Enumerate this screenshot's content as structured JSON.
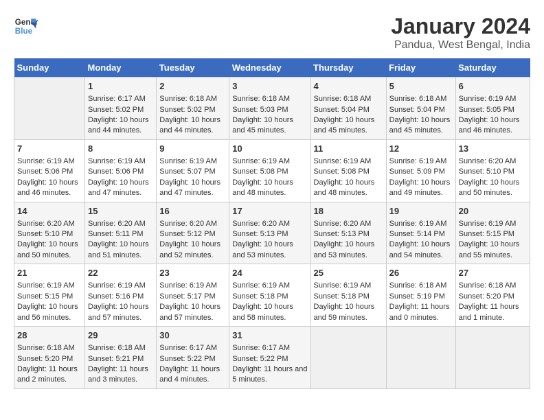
{
  "logo": {
    "text_general": "General",
    "text_blue": "Blue"
  },
  "title": "January 2024",
  "subtitle": "Pandua, West Bengal, India",
  "calendar": {
    "headers": [
      "Sunday",
      "Monday",
      "Tuesday",
      "Wednesday",
      "Thursday",
      "Friday",
      "Saturday"
    ],
    "weeks": [
      [
        {
          "day": "",
          "sunrise": "",
          "sunset": "",
          "daylight": ""
        },
        {
          "day": "1",
          "sunrise": "Sunrise: 6:17 AM",
          "sunset": "Sunset: 5:02 PM",
          "daylight": "Daylight: 10 hours and 44 minutes."
        },
        {
          "day": "2",
          "sunrise": "Sunrise: 6:18 AM",
          "sunset": "Sunset: 5:02 PM",
          "daylight": "Daylight: 10 hours and 44 minutes."
        },
        {
          "day": "3",
          "sunrise": "Sunrise: 6:18 AM",
          "sunset": "Sunset: 5:03 PM",
          "daylight": "Daylight: 10 hours and 45 minutes."
        },
        {
          "day": "4",
          "sunrise": "Sunrise: 6:18 AM",
          "sunset": "Sunset: 5:04 PM",
          "daylight": "Daylight: 10 hours and 45 minutes."
        },
        {
          "day": "5",
          "sunrise": "Sunrise: 6:18 AM",
          "sunset": "Sunset: 5:04 PM",
          "daylight": "Daylight: 10 hours and 45 minutes."
        },
        {
          "day": "6",
          "sunrise": "Sunrise: 6:19 AM",
          "sunset": "Sunset: 5:05 PM",
          "daylight": "Daylight: 10 hours and 46 minutes."
        }
      ],
      [
        {
          "day": "7",
          "sunrise": "Sunrise: 6:19 AM",
          "sunset": "Sunset: 5:06 PM",
          "daylight": "Daylight: 10 hours and 46 minutes."
        },
        {
          "day": "8",
          "sunrise": "Sunrise: 6:19 AM",
          "sunset": "Sunset: 5:06 PM",
          "daylight": "Daylight: 10 hours and 47 minutes."
        },
        {
          "day": "9",
          "sunrise": "Sunrise: 6:19 AM",
          "sunset": "Sunset: 5:07 PM",
          "daylight": "Daylight: 10 hours and 47 minutes."
        },
        {
          "day": "10",
          "sunrise": "Sunrise: 6:19 AM",
          "sunset": "Sunset: 5:08 PM",
          "daylight": "Daylight: 10 hours and 48 minutes."
        },
        {
          "day": "11",
          "sunrise": "Sunrise: 6:19 AM",
          "sunset": "Sunset: 5:08 PM",
          "daylight": "Daylight: 10 hours and 48 minutes."
        },
        {
          "day": "12",
          "sunrise": "Sunrise: 6:19 AM",
          "sunset": "Sunset: 5:09 PM",
          "daylight": "Daylight: 10 hours and 49 minutes."
        },
        {
          "day": "13",
          "sunrise": "Sunrise: 6:20 AM",
          "sunset": "Sunset: 5:10 PM",
          "daylight": "Daylight: 10 hours and 50 minutes."
        }
      ],
      [
        {
          "day": "14",
          "sunrise": "Sunrise: 6:20 AM",
          "sunset": "Sunset: 5:10 PM",
          "daylight": "Daylight: 10 hours and 50 minutes."
        },
        {
          "day": "15",
          "sunrise": "Sunrise: 6:20 AM",
          "sunset": "Sunset: 5:11 PM",
          "daylight": "Daylight: 10 hours and 51 minutes."
        },
        {
          "day": "16",
          "sunrise": "Sunrise: 6:20 AM",
          "sunset": "Sunset: 5:12 PM",
          "daylight": "Daylight: 10 hours and 52 minutes."
        },
        {
          "day": "17",
          "sunrise": "Sunrise: 6:20 AM",
          "sunset": "Sunset: 5:13 PM",
          "daylight": "Daylight: 10 hours and 53 minutes."
        },
        {
          "day": "18",
          "sunrise": "Sunrise: 6:20 AM",
          "sunset": "Sunset: 5:13 PM",
          "daylight": "Daylight: 10 hours and 53 minutes."
        },
        {
          "day": "19",
          "sunrise": "Sunrise: 6:19 AM",
          "sunset": "Sunset: 5:14 PM",
          "daylight": "Daylight: 10 hours and 54 minutes."
        },
        {
          "day": "20",
          "sunrise": "Sunrise: 6:19 AM",
          "sunset": "Sunset: 5:15 PM",
          "daylight": "Daylight: 10 hours and 55 minutes."
        }
      ],
      [
        {
          "day": "21",
          "sunrise": "Sunrise: 6:19 AM",
          "sunset": "Sunset: 5:15 PM",
          "daylight": "Daylight: 10 hours and 56 minutes."
        },
        {
          "day": "22",
          "sunrise": "Sunrise: 6:19 AM",
          "sunset": "Sunset: 5:16 PM",
          "daylight": "Daylight: 10 hours and 57 minutes."
        },
        {
          "day": "23",
          "sunrise": "Sunrise: 6:19 AM",
          "sunset": "Sunset: 5:17 PM",
          "daylight": "Daylight: 10 hours and 57 minutes."
        },
        {
          "day": "24",
          "sunrise": "Sunrise: 6:19 AM",
          "sunset": "Sunset: 5:18 PM",
          "daylight": "Daylight: 10 hours and 58 minutes."
        },
        {
          "day": "25",
          "sunrise": "Sunrise: 6:19 AM",
          "sunset": "Sunset: 5:18 PM",
          "daylight": "Daylight: 10 hours and 59 minutes."
        },
        {
          "day": "26",
          "sunrise": "Sunrise: 6:18 AM",
          "sunset": "Sunset: 5:19 PM",
          "daylight": "Daylight: 11 hours and 0 minutes."
        },
        {
          "day": "27",
          "sunrise": "Sunrise: 6:18 AM",
          "sunset": "Sunset: 5:20 PM",
          "daylight": "Daylight: 11 hours and 1 minute."
        }
      ],
      [
        {
          "day": "28",
          "sunrise": "Sunrise: 6:18 AM",
          "sunset": "Sunset: 5:20 PM",
          "daylight": "Daylight: 11 hours and 2 minutes."
        },
        {
          "day": "29",
          "sunrise": "Sunrise: 6:18 AM",
          "sunset": "Sunset: 5:21 PM",
          "daylight": "Daylight: 11 hours and 3 minutes."
        },
        {
          "day": "30",
          "sunrise": "Sunrise: 6:17 AM",
          "sunset": "Sunset: 5:22 PM",
          "daylight": "Daylight: 11 hours and 4 minutes."
        },
        {
          "day": "31",
          "sunrise": "Sunrise: 6:17 AM",
          "sunset": "Sunset: 5:22 PM",
          "daylight": "Daylight: 11 hours and 5 minutes."
        },
        {
          "day": "",
          "sunrise": "",
          "sunset": "",
          "daylight": ""
        },
        {
          "day": "",
          "sunrise": "",
          "sunset": "",
          "daylight": ""
        },
        {
          "day": "",
          "sunrise": "",
          "sunset": "",
          "daylight": ""
        }
      ]
    ]
  }
}
